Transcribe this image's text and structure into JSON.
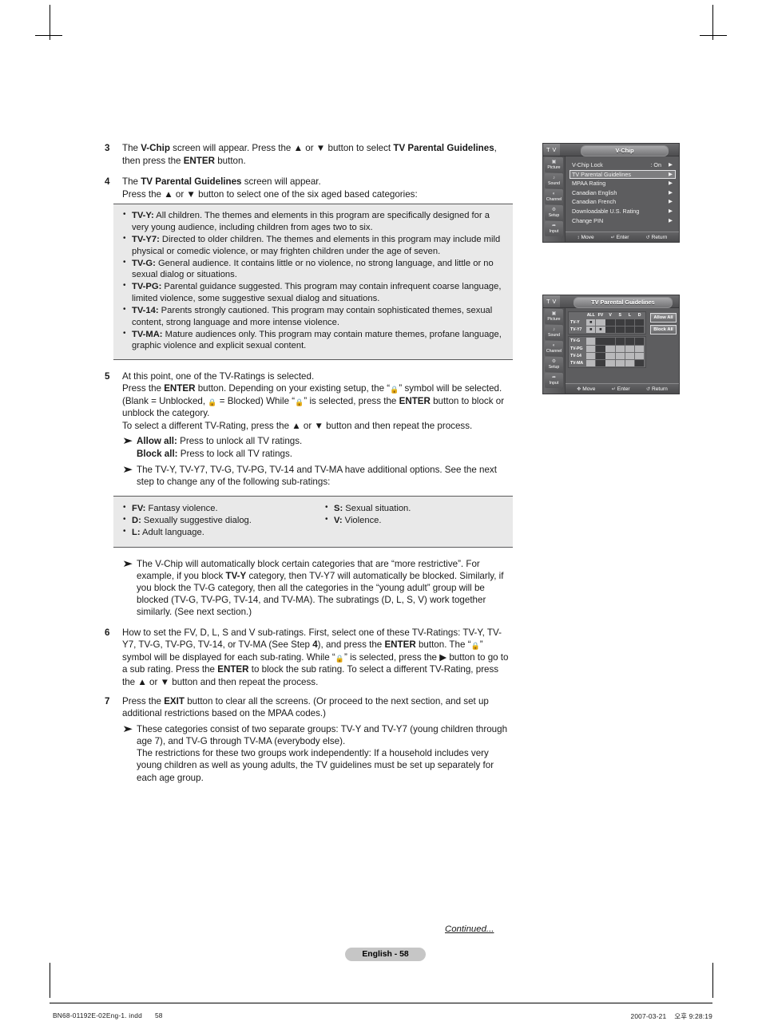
{
  "page": {
    "page_label": "English - 58",
    "continued": "Continued...",
    "footer_left_file": "BN68-01192E-02Eng-1. indd",
    "footer_left_page": "58",
    "footer_right_date": "2007-03-21",
    "footer_right_time": "오후 9:28:19"
  },
  "steps": [
    {
      "num": "3",
      "parts": [
        {
          "t": "The ",
          "b": false
        },
        {
          "t": "V-Chip",
          "b": true
        },
        {
          "t": " screen will appear. Press the ▲ or ▼ button to select ",
          "b": false
        },
        {
          "t": "TV Parental Guidelines",
          "b": true
        },
        {
          "t": ", then press the ",
          "b": false
        },
        {
          "t": "ENTER",
          "b": true
        },
        {
          "t": " button.",
          "b": false
        }
      ]
    },
    {
      "num": "4",
      "parts": [
        {
          "t": "The ",
          "b": false
        },
        {
          "t": "TV Parental Guidelines",
          "b": true
        },
        {
          "t": " screen will appear.",
          "b": false
        },
        {
          "t": "\n",
          "b": false
        },
        {
          "t": "Press the ▲ or ▼ button to select one of the six aged based categories:",
          "b": false
        }
      ]
    },
    {
      "num": "5",
      "parts": [
        {
          "t": "At this point, one of the TV-Ratings is selected.",
          "b": false
        },
        {
          "t": "\n",
          "b": false
        },
        {
          "t": "Press the ",
          "b": false
        },
        {
          "t": "ENTER",
          "b": true
        },
        {
          "t": " button. Depending on your existing setup, the “ ■ ” symbol will be selected. (Blank = Unblocked, ■ = Blocked) While “ ■ ” is selected, press the ",
          "b": false
        },
        {
          "t": "ENTER",
          "b": true
        },
        {
          "t": " button to block or unblock the category.",
          "b": false
        },
        {
          "t": "\n",
          "b": false
        },
        {
          "t": "To select a different TV-Rating, press the ▲ or ▼ button and then repeat the process.",
          "b": false
        }
      ]
    },
    {
      "num": "6",
      "parts": [
        {
          "t": "How to set the FV, D, L, S and V sub-ratings. First, select one of these TV-Ratings: TV-Y, TV-Y7, TV-G, TV-PG, TV-14, or TV-MA (See Step ",
          "b": false
        },
        {
          "t": "4",
          "b": true
        },
        {
          "t": "), and press the ",
          "b": false
        },
        {
          "t": "ENTER",
          "b": true
        },
        {
          "t": " button. The “ ■ ” symbol will be displayed for each sub-rating. While “ ■ ” is selected, press the ▶ button to go to a sub rating. Press the ",
          "b": false
        },
        {
          "t": "ENTER",
          "b": true
        },
        {
          "t": " to block the sub rating. To select a different TV-Rating, press the ▲ or ▼ button and then repeat the process.",
          "b": false
        }
      ]
    },
    {
      "num": "7",
      "parts": [
        {
          "t": "Press the ",
          "b": false
        },
        {
          "t": "EXIT",
          "b": true
        },
        {
          "t": " button to clear all the screens. (Or proceed to the next section, and set up additional restrictions based on the MPAA codes.)",
          "b": false
        }
      ]
    }
  ],
  "ratings_box": {
    "items": [
      {
        "term": "TV-Y:",
        "desc": " All children. The themes and elements in this program are specifically designed for a very young audience, including children from ages two to six."
      },
      {
        "term": "TV-Y7:",
        "desc": " Directed to older children. The themes and elements in this program may include mild physical or comedic violence, or may frighten children under the age of seven."
      },
      {
        "term": "TV-G:",
        "desc": " General audience. It contains little or no violence, no strong language, and little or no sexual dialog or situations."
      },
      {
        "term": "TV-PG:",
        "desc": " Parental guidance suggested. This program may contain infrequent coarse language, limited violence, some suggestive sexual dialog and situations."
      },
      {
        "term": "TV-14:",
        "desc": " Parents strongly cautioned. This program may contain sophisticated themes, sexual content, strong language and more intense violence."
      },
      {
        "term": "TV-MA:",
        "desc": " Mature audiences only. This program may contain mature themes, profane language, graphic violence and explicit sexual content."
      }
    ]
  },
  "allow_block_notes": {
    "allow_all_term": "Allow all:",
    "allow_all_desc": " Press to unlock all TV ratings.",
    "block_all_term": "Block all:",
    "block_all_desc": " Press to lock all TV ratings.",
    "additional_options": "The TV-Y, TV-Y7, TV-G, TV-PG, TV-14 and TV-MA have additional options. See the next step to change any of the following sub-ratings:"
  },
  "subratings_box": {
    "col_a": [
      {
        "term": "FV:",
        "desc": " Fantasy violence."
      },
      {
        "term": "D:",
        "desc": " Sexually suggestive dialog."
      },
      {
        "term": "L:",
        "desc": " Adult language."
      }
    ],
    "col_b": [
      {
        "term": "S:",
        "desc": " Sexual situation."
      },
      {
        "term": "V:",
        "desc": " Violence."
      }
    ]
  },
  "vchip_note": {
    "parts": [
      {
        "t": "The V-Chip will automatically block certain categories that are “more restrictive”. For example, if you block ",
        "b": false
      },
      {
        "t": "TV-Y",
        "b": true
      },
      {
        "t": " category, then TV-Y7 will automatically be blocked. Similarly, if you block the TV-G category, then all the categories in the “young adult” group will be blocked (TV-G, TV-PG, TV-14, and TV-MA). The subratings (D, L, S, V) work together similarly. (See next section.)",
        "b": false
      }
    ]
  },
  "groups_note": {
    "text": "These categories consist of two separate groups: TV-Y and TV-Y7 (young children through age 7), and TV-G through TV-MA (everybody else).\nThe restrictions for these two groups work independently: If a household includes very young children as well as young adults, the TV guidelines must be set up separately for each age group."
  },
  "osd_vchip": {
    "tv_label": "T V",
    "title": "V-Chip",
    "sidebar": [
      {
        "label": "Picture",
        "icon": "picture-icon",
        "glyph": "▣"
      },
      {
        "label": "Sound",
        "icon": "sound-icon",
        "glyph": "♪"
      },
      {
        "label": "Channel",
        "icon": "channel-icon",
        "glyph": "◐"
      },
      {
        "label": "Setup",
        "icon": "setup-icon",
        "glyph": "⚙"
      },
      {
        "label": "Input",
        "icon": "input-icon",
        "glyph": "➦"
      }
    ],
    "rows": [
      {
        "label": "V-Chip Lock",
        "value": ": On",
        "arrow": "▶",
        "selected": false
      },
      {
        "label": "TV Parental Guidelines",
        "value": "",
        "arrow": "▶",
        "selected": true
      },
      {
        "label": "MPAA Rating",
        "value": "",
        "arrow": "▶",
        "selected": false
      },
      {
        "label": "Canadian English",
        "value": "",
        "arrow": "▶",
        "selected": false
      },
      {
        "label": "Canadian French",
        "value": "",
        "arrow": "▶",
        "selected": false
      },
      {
        "label": "Downloadable U.S. Rating",
        "value": "",
        "arrow": "▶",
        "selected": false
      },
      {
        "label": "Change PIN",
        "value": "",
        "arrow": "▶",
        "selected": false
      }
    ],
    "help": {
      "move": "Move",
      "enter": "Enter",
      "return": "Return",
      "move_key": "↕",
      "enter_key": "↵",
      "return_key": "↺"
    }
  },
  "osd_guidelines": {
    "tv_label": "T V",
    "title": "TV Parental Guidelines",
    "sidebar": [
      {
        "label": "Picture",
        "icon": "picture-icon",
        "glyph": "▣"
      },
      {
        "label": "Sound",
        "icon": "sound-icon",
        "glyph": "♪"
      },
      {
        "label": "Channel",
        "icon": "channel-icon",
        "glyph": "◐"
      },
      {
        "label": "Setup",
        "icon": "setup-icon",
        "glyph": "⚙"
      },
      {
        "label": "Input",
        "icon": "input-icon",
        "glyph": "➦"
      }
    ],
    "columns": [
      "ALL",
      "FV",
      "V",
      "S",
      "L",
      "D"
    ],
    "group_young": [
      {
        "label": "TV-Y",
        "cells": [
          "lock",
          "light",
          "dark",
          "dark",
          "dark",
          "dark"
        ]
      },
      {
        "label": "TV-Y7",
        "cells": [
          "lock",
          "lock",
          "dark",
          "dark",
          "dark",
          "dark"
        ]
      }
    ],
    "group_adult": [
      {
        "label": "TV-G",
        "cells": [
          "light",
          "dark",
          "dark",
          "dark",
          "dark",
          "dark"
        ]
      },
      {
        "label": "TV-PG",
        "cells": [
          "light",
          "dark",
          "light",
          "light",
          "light",
          "light"
        ]
      },
      {
        "label": "TV-14",
        "cells": [
          "light",
          "dark",
          "light",
          "light",
          "light",
          "light"
        ]
      },
      {
        "label": "TV-MA",
        "cells": [
          "light",
          "dark",
          "light",
          "light",
          "light",
          "dark"
        ]
      }
    ],
    "buttons": {
      "allow_all": "Allow All",
      "block_all": "Block All"
    },
    "help": {
      "move": "Move",
      "enter": "Enter",
      "return": "Return",
      "move_key": "✥",
      "enter_key": "↵",
      "return_key": "↺"
    }
  }
}
